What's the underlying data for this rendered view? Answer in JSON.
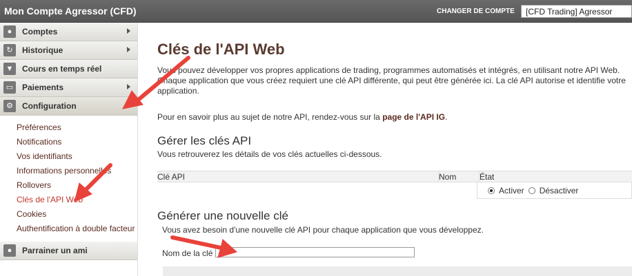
{
  "header": {
    "title": "Mon Compte Agressor (CFD)",
    "switch_label": "CHANGER DE COMPTE",
    "account_value": "[CFD Trading] Agressor"
  },
  "sidebar": {
    "items": [
      {
        "label": "Comptes",
        "icon": "user-icon"
      },
      {
        "label": "Historique",
        "icon": "history-icon"
      },
      {
        "label": "Cours en temps réel",
        "icon": "filter-icon"
      },
      {
        "label": "Paiements",
        "icon": "card-icon"
      },
      {
        "label": "Configuration",
        "icon": "gear-icon"
      }
    ],
    "subitems": [
      "Préférences",
      "Notifications",
      "Vos identifiants",
      "Informations personnelles",
      "Rollovers",
      "Clés de l'API Web",
      "Cookies",
      "Authentification à double facteur"
    ],
    "refer": "Parrainer un ami"
  },
  "main": {
    "title": "Clés de l'API Web",
    "intro": "Vous pouvez développer vos propres applications de trading, programmes automatisés et intégrés, en utilisant notre API Web. Chaque application que vous créez requiert une clé API différente, qui peut être générée ici. La clé API autorise et identifie votre application.",
    "more_prefix": "Pour en savoir plus au sujet de notre API, rendez-vous sur la ",
    "more_link": "page de l'API IG",
    "more_suffix": ".",
    "manage_title": "Gérer les clés API",
    "manage_sub": "Vous retrouverez les détails de vos clés actuelles ci-dessous.",
    "table_headers": [
      "Clé API",
      "Nom",
      "État"
    ],
    "state_on": "Activer",
    "state_off": "Désactiver",
    "generate_title": "Générer une nouvelle clé",
    "generate_sub": "Vous avez besoin d'une nouvelle clé API pour chaque application que vous développez.",
    "key_name_label": "Nom de la clé",
    "key_name_value": ""
  },
  "colors": {
    "arrow": "#e8423a",
    "link": "#5a2a1e",
    "current": "#c0352b"
  }
}
